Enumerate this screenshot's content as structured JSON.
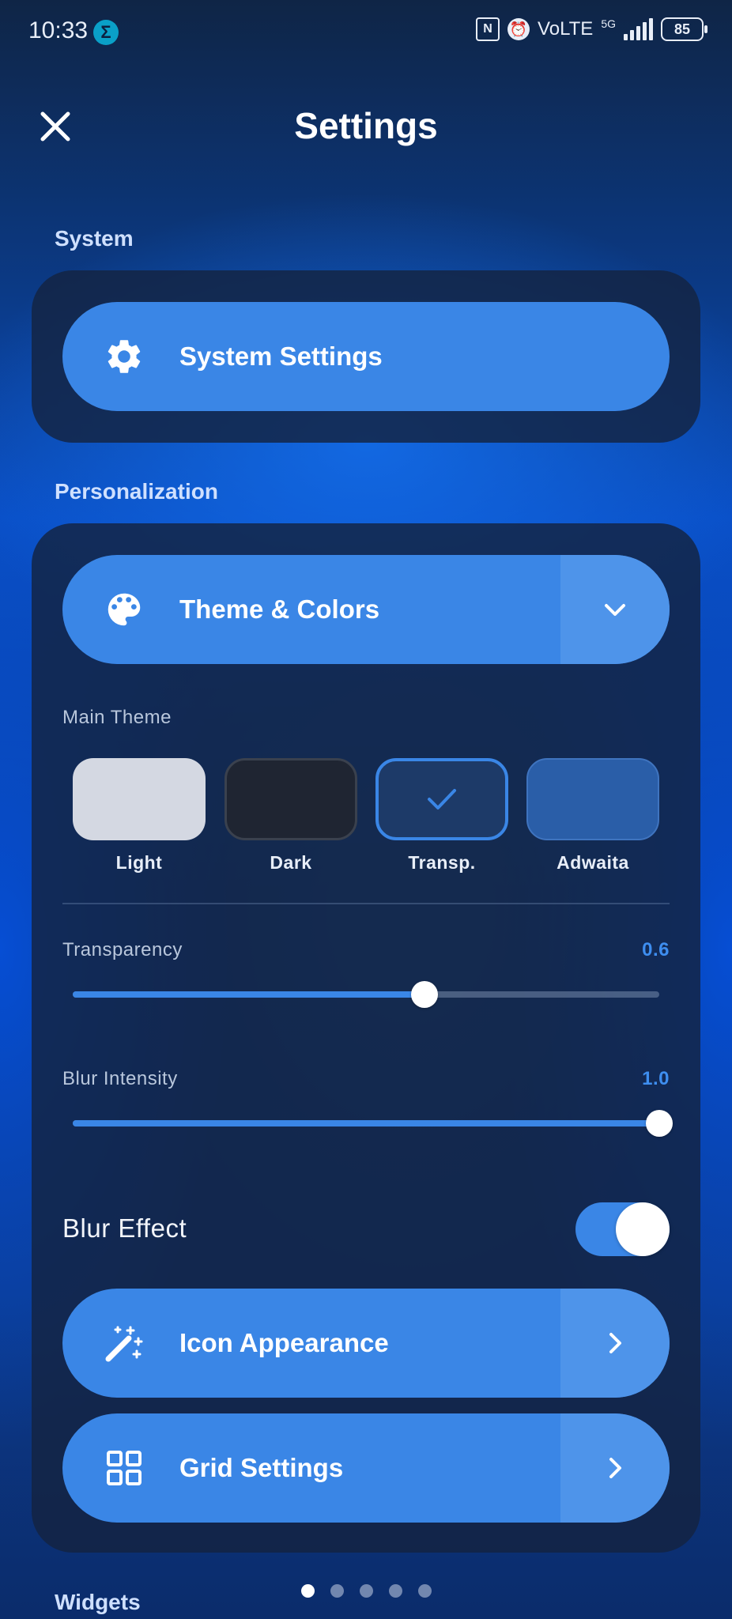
{
  "status_bar": {
    "time": "10:33",
    "app_indicator": "Σ",
    "nfc": "N",
    "network": "VoLTE",
    "network_gen": "5G",
    "battery": "85"
  },
  "header": {
    "title": "Settings",
    "close_icon": "close-icon"
  },
  "sections": {
    "system": {
      "label": "System",
      "system_settings": {
        "label": "System Settings",
        "icon": "gear-icon"
      }
    },
    "personalization": {
      "label": "Personalization",
      "theme_colors": {
        "label": "Theme & Colors",
        "icon": "palette-icon",
        "end_icon": "chevron-down-icon"
      },
      "main_theme": {
        "label": "Main Theme",
        "selected": "Transp.",
        "options": [
          {
            "name": "Light",
            "color": "#d4d8e2"
          },
          {
            "name": "Dark",
            "color": "#1f2532"
          },
          {
            "name": "Transp.",
            "color": "#1d3a68"
          },
          {
            "name": "Adwaita",
            "color": "#2a5ea8"
          }
        ]
      },
      "transparency": {
        "label": "Transparency",
        "value": "0.6",
        "fraction": 0.6
      },
      "blur_intensity": {
        "label": "Blur Intensity",
        "value": "1.0",
        "fraction": 1.0
      },
      "blur_effect": {
        "label": "Blur Effect",
        "on": true
      },
      "icon_appearance": {
        "label": "Icon Appearance",
        "icon": "magic-wand-icon",
        "end_icon": "chevron-right-icon"
      },
      "grid_settings": {
        "label": "Grid Settings",
        "icon": "grid-icon",
        "end_icon": "chevron-right-icon"
      }
    },
    "widgets": {
      "label": "Widgets"
    }
  },
  "pager": {
    "count": 5,
    "active": 1
  },
  "colors": {
    "accent": "#3a86e6",
    "value_text": "#3e8ef0"
  }
}
